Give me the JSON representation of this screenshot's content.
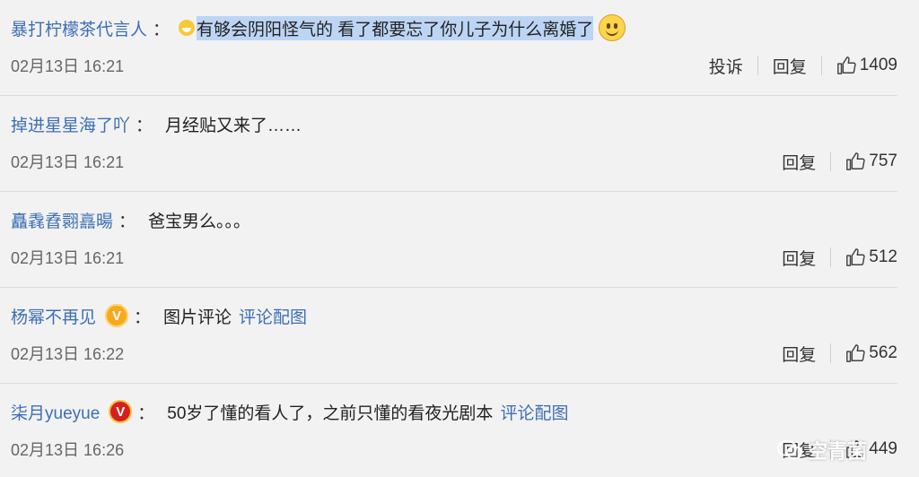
{
  "comments": [
    {
      "user": "暴打柠檬茶代言人",
      "colon": "：",
      "text_selected": "有够会阴阳怪气的 看了都要忘了你儿子为什么离婚了",
      "time": "02月13日 16:21",
      "report_label": "投诉",
      "reply_label": "回复",
      "likes": "1409"
    },
    {
      "user": "掉进星星海了吖",
      "colon": "：",
      "text": "月经贴又来了……",
      "time": "02月13日 16:21",
      "reply_label": "回复",
      "likes": "757"
    },
    {
      "user": "矗毳孴翾譶暘",
      "colon": "：",
      "text": "爸宝男么。。。",
      "time": "02月13日 16:21",
      "reply_label": "回复",
      "likes": "512"
    },
    {
      "user": "杨幂不再见",
      "badge": "V",
      "colon": "：",
      "text": "图片评论",
      "pic_link": "评论配图",
      "time": "02月13日 16:22",
      "reply_label": "回复",
      "likes": "562"
    },
    {
      "user": "柒月yueyue",
      "badge": "V",
      "colon": "：",
      "text": "50岁了懂的看人了，之前只懂的看夜光剧本",
      "pic_link": "评论配图",
      "time": "02月13日 16:26",
      "reply_label": "回复",
      "likes": "449"
    }
  ],
  "watermark": "空青菌",
  "colors": {
    "username": "#3d6fb4",
    "selection": "#bcd5f5",
    "badge_gold": "#f7a91d",
    "badge_red": "#d6201d"
  },
  "icons": {
    "like": "thumbs-up-icon",
    "watermark": "wechat-icon"
  }
}
